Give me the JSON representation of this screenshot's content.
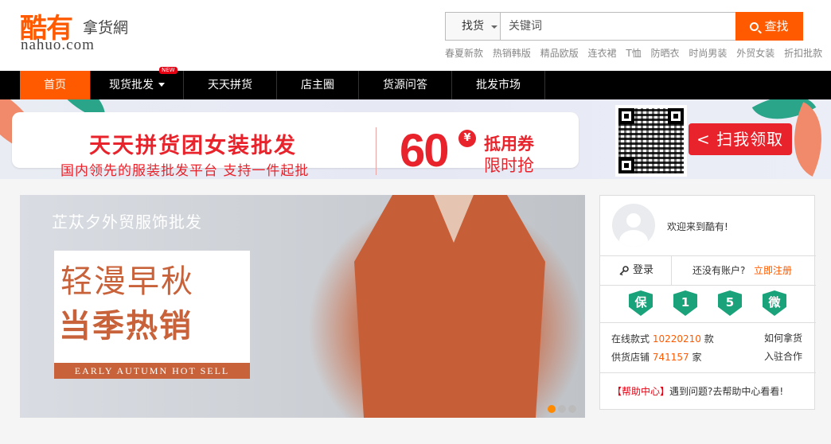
{
  "logo": {
    "main": "酷有",
    "sub": "拿货網",
    "domain": "nahuo.com"
  },
  "search": {
    "category": "找货",
    "placeholder": "关键词",
    "button": "查找",
    "hot_words": [
      "春夏新款",
      "热销韩版",
      "精品欧版",
      "连衣裙",
      "T恤",
      "防晒衣",
      "时尚男装",
      "外贸女装",
      "折扣批款"
    ]
  },
  "nav": {
    "items": [
      {
        "label": "首页"
      },
      {
        "label": "现货批发",
        "badge": "NEW"
      },
      {
        "label": "天天拼货"
      },
      {
        "label": "店主圈"
      },
      {
        "label": "货源问答"
      },
      {
        "label": "批发市场"
      }
    ]
  },
  "promo": {
    "title": "天天拼货团女装批发",
    "subtitle": "国内领先的服装批发平台  支持一件起批",
    "amount": "60",
    "currency": "¥",
    "coupon": "抵用券",
    "limited": "限时抢",
    "scan": "< 扫我领取"
  },
  "hero": {
    "brand": "芷苁夕外贸服饰批发",
    "line1": "轻漫早秋",
    "line2": "当季热销",
    "english": "EARLY AUTUMN HOT SELL"
  },
  "panel": {
    "welcome": "欢迎来到酷有!",
    "login": "登录",
    "no_account": "还没有账户?",
    "register": "立即注册",
    "badges": [
      "保",
      "1",
      "5",
      "微"
    ],
    "online_label": "在线款式",
    "online_value": "10220210",
    "online_unit": "款",
    "stores_label": "供货店铺",
    "stores_value": "741157",
    "stores_unit": "家",
    "how_to": "如何拿货",
    "join": "入驻合作",
    "help_link": "【帮助中心】",
    "help_text": "遇到问题?去帮助中心看看!"
  },
  "colors": {
    "accent": "#ff5a00",
    "promo_red": "#e8232b",
    "badge_green": "#1aa27a"
  }
}
